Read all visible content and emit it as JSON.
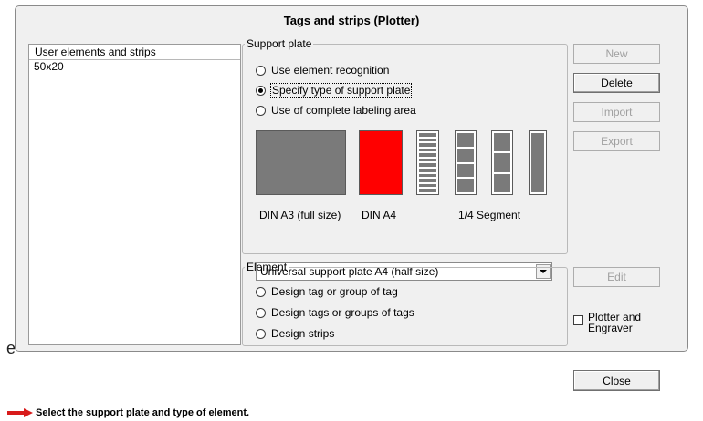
{
  "dialog": {
    "title": "Tags and strips (Plotter)"
  },
  "list": {
    "header": "User elements and strips",
    "items": [
      "50x20"
    ]
  },
  "support_plate": {
    "legend": "Support plate",
    "options": [
      {
        "label": "Use element recognition",
        "checked": false
      },
      {
        "label": "Specify type of support plate",
        "checked": true
      },
      {
        "label": "Use of complete labeling area",
        "checked": false
      }
    ],
    "captions": [
      "DIN A3 (full size)",
      "DIN A4",
      "1/4 Segment"
    ],
    "selected_plate": "Universal support plate A4 (half size)",
    "colors": {
      "plate": "#7a7a7a",
      "selected_plate": "#ff0000"
    }
  },
  "element": {
    "legend": "Element",
    "options": [
      {
        "label": "Design tag or group of tag",
        "checked": false
      },
      {
        "label": "Design tags or groups of tags",
        "checked": false
      },
      {
        "label": "Design strips",
        "checked": false
      }
    ]
  },
  "buttons": {
    "new": "New",
    "delete": "Delete",
    "import": "Import",
    "export": "Export",
    "edit": "Edit",
    "close": "Close"
  },
  "plotter_checkbox": {
    "label": "Plotter and Engraver",
    "checked": false
  },
  "edge_glyph": "e",
  "hint": {
    "text": "Select the support plate and type of element.",
    "arrow_color": "#d81b1b"
  }
}
